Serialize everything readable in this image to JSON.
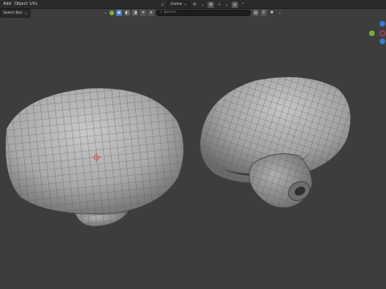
{
  "menu": {
    "add": "Add",
    "object": "Object",
    "uv": "UVs"
  },
  "header": {
    "select_mode": "Select Box",
    "transform_orientation": "Global",
    "search_placeholder": "Search"
  },
  "gizmo": {
    "x_color": "#d1485a",
    "y_color": "#7cad3a",
    "z_color": "#3a7bd5"
  },
  "mesh_color": "#b9b9b9",
  "wire_color": "#585858"
}
